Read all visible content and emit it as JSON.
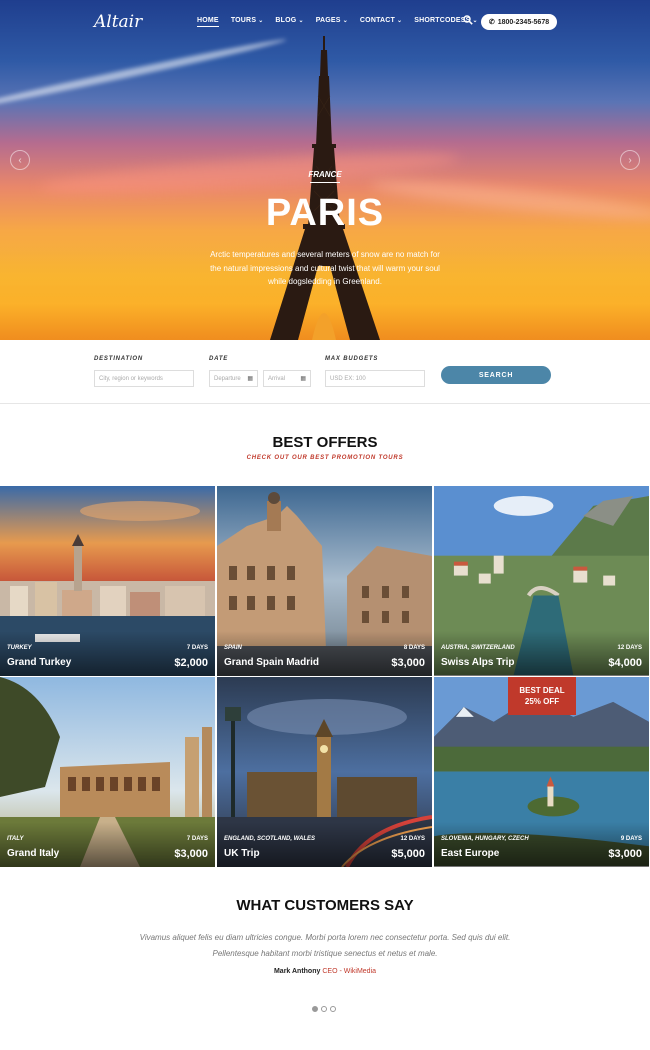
{
  "nav": {
    "logo": "Altair",
    "items": [
      {
        "label": "HOME",
        "caret": false
      },
      {
        "label": "TOURS",
        "caret": true
      },
      {
        "label": "BLOG",
        "caret": true
      },
      {
        "label": "PAGES",
        "caret": true
      },
      {
        "label": "CONTACT",
        "caret": true
      },
      {
        "label": "SHORTCODESS",
        "caret": true
      }
    ],
    "phone": "1800-2345-5678"
  },
  "hero": {
    "subtitle": "FRANCE",
    "title": "PARIS",
    "description": "Arctic temperatures and several meters of snow are no match for the natural impressions and cultural twist that will warm your soul while dogsledding in Greenland."
  },
  "search": {
    "destination_label": "DESTINATION",
    "destination_placeholder": "City, region or keywords",
    "date_label": "DATE",
    "departure_placeholder": "Departure",
    "arrival_placeholder": "Arrival",
    "budget_label": "MAX BUDGETS",
    "budget_placeholder": "USD EX: 100",
    "button": "SEARCH"
  },
  "offers": {
    "title": "BEST OFFERS",
    "subtitle": "CHECK OUT OUR BEST PROMOTION TOURS",
    "cards": [
      {
        "country": "TURKEY",
        "days": "7 DAYS",
        "name": "Grand Turkey",
        "price": "$2,000"
      },
      {
        "country": "SPAIN",
        "days": "8 DAYS",
        "name": "Grand Spain Madrid",
        "price": "$3,000"
      },
      {
        "country": "AUSTRIA, SWITZERLAND",
        "days": "12 DAYS",
        "name": "Swiss Alps Trip",
        "price": "$4,000"
      },
      {
        "country": "ITALY",
        "days": "7 DAYS",
        "name": "Grand Italy",
        "price": "$3,000"
      },
      {
        "country": "ENGLAND, SCOTLAND, WALES",
        "days": "12 DAYS",
        "name": "UK Trip",
        "price": "$5,000"
      },
      {
        "country": "SLOVENIA, HUNGARY, CZECH",
        "days": "9 DAYS",
        "name": "East Europe",
        "price": "$3,000"
      }
    ],
    "deal_line1": "BEST DEAL",
    "deal_line2": "25% OFF"
  },
  "testimonials": {
    "title": "WHAT CUSTOMERS SAY",
    "quote": "Vivamus aliquet felis eu diam ultricies congue. Morbi porta lorem nec consectetur porta. Sed quis dui elit. Pellentesque habitant morbi tristique senectus et netus et male.",
    "author": "Mark Anthony",
    "role": "CEO - WikiMedia",
    "active_dot": 1
  },
  "colors": {
    "accent": "#c0392b",
    "button": "#4c86a8"
  }
}
